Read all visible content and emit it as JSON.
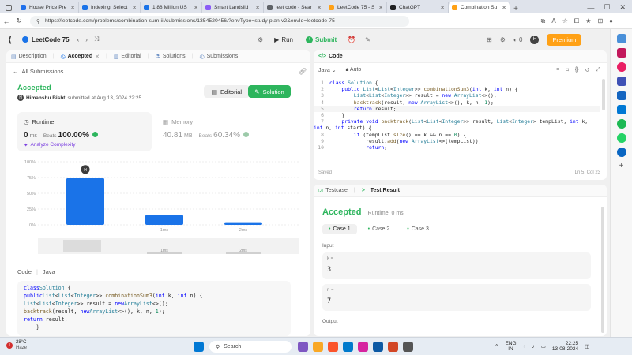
{
  "browser": {
    "tabs": [
      {
        "label": "House Price Pre",
        "color": "#1f6feb"
      },
      {
        "label": "Indexing, Select",
        "color": "#1a73e8"
      },
      {
        "label": "1.88 Million US",
        "color": "#1a73e8"
      },
      {
        "label": "Smart Landslid",
        "color": "#8b5cf6"
      },
      {
        "label": "leet code - Sear",
        "color": "#5f6368"
      },
      {
        "label": "LeetCode 75 - S",
        "color": "#ffa116"
      },
      {
        "label": "ChatGPT",
        "color": "#202123"
      },
      {
        "label": "Combination Su",
        "color": "#ffa116"
      }
    ],
    "url": "https://leetcode.com/problems/combination-sum-iii/submissions/1354520456/?envType=study-plan-v2&envId=leetcode-75"
  },
  "toolbar": {
    "study_plan": "LeetCode 75",
    "run": "Run",
    "submit": "Submit",
    "fire_count": "0",
    "avatar": "H",
    "premium": "Premium"
  },
  "left_tabs": [
    "Description",
    "Accepted",
    "Editorial",
    "Solutions",
    "Submissions"
  ],
  "submission": {
    "back": "All Submissions",
    "status": "Accepted",
    "user_initial": "H",
    "user": "Himanshu Bisht",
    "submitted": "submitted at Aug 13, 2024 22:25",
    "editorial_btn": "Editorial",
    "solution_btn": "Solution",
    "runtime_label": "Runtime",
    "runtime_value": "0",
    "runtime_unit": "ms",
    "runtime_beats_label": "Beats",
    "runtime_beats": "100.00%",
    "analyze": "Analyze Complexity",
    "memory_label": "Memory",
    "memory_value": "40.81",
    "memory_unit": "MB",
    "memory_beats_label": "Beats",
    "memory_beats": "60.34%"
  },
  "chart_data": {
    "type": "bar",
    "y_ticks": [
      "100%",
      "75%",
      "50%",
      "25%",
      "0%"
    ],
    "ylim": [
      0,
      100
    ],
    "categories": [
      "",
      "1ms",
      "2ms"
    ],
    "values": [
      74,
      16,
      3
    ],
    "marker_label": "H",
    "mini_labels": [
      "1ms",
      "2ms"
    ]
  },
  "code_section": {
    "title": "Code",
    "lang": "Java",
    "lines": [
      "class Solution {",
      "    public List<List<Integer>> combinationSum3(int k, int n) {",
      "        List<List<Integer>> result = new ArrayList<>();",
      "        backtrack(result, new ArrayList<>(), k, n, 1);",
      "        return result;",
      "    }"
    ]
  },
  "editor": {
    "title": "Code",
    "lang": "Java",
    "mode": "Auto",
    "status_left": "Saved",
    "status_right": "Ln 5, Col 23",
    "lines": [
      {
        "n": "1",
        "t": "class Solution {"
      },
      {
        "n": "2",
        "t": "    public List<List<Integer>> combinationSum3(int k, int n) {"
      },
      {
        "n": "3",
        "t": "        List<List<Integer>> result = new ArrayList<>();"
      },
      {
        "n": "4",
        "t": "        backtrack(result, new ArrayList<>(), k, n, 1);"
      },
      {
        "n": "5",
        "t": "        return result;"
      },
      {
        "n": "6",
        "t": "    }"
      },
      {
        "n": "7",
        "t": "    private void backtrack(List<List<Integer>> result, List<Integer> tempList, int k,"
      },
      {
        "n": "",
        "t": "int n, int start) {"
      },
      {
        "n": "8",
        "t": "        if (tempList.size() == k && n == 0) {"
      },
      {
        "n": "9",
        "t": "            result.add(new ArrayList<>(tempList));"
      },
      {
        "n": "10",
        "t": "            return;"
      }
    ]
  },
  "result": {
    "tab_testcase": "Testcase",
    "tab_result": "Test Result",
    "status": "Accepted",
    "runtime": "Runtime: 0 ms",
    "cases": [
      "Case 1",
      "Case 2",
      "Case 3"
    ],
    "input_label": "Input",
    "k_label": "k =",
    "k_value": "3",
    "n_label": "n =",
    "n_value": "7",
    "output_label": "Output"
  },
  "taskbar": {
    "temp": "28°C",
    "weather": "Haze",
    "badge": "1",
    "search": "Search",
    "lang1": "ENG",
    "lang2": "IN",
    "time": "22:25",
    "date": "13-08-2024"
  }
}
